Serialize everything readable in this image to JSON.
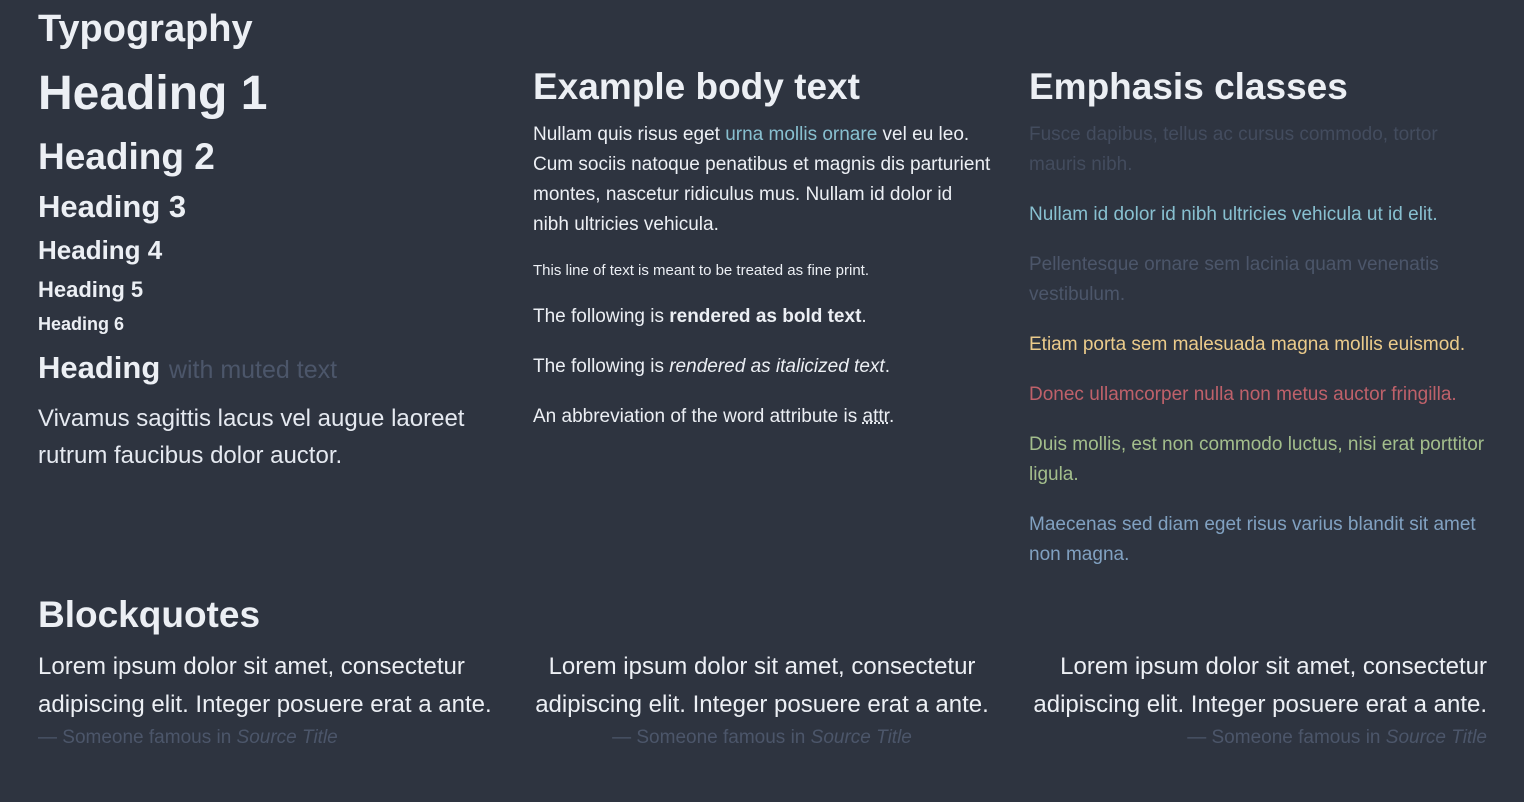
{
  "page": {
    "title": "Typography"
  },
  "headings": {
    "h1": "Heading 1",
    "h2": "Heading 2",
    "h3": "Heading 3",
    "h4": "Heading 4",
    "h5": "Heading 5",
    "h6": "Heading 6",
    "muted_heading": "Heading",
    "muted_text": "with muted text",
    "lead": "Vivamus sagittis lacus vel augue laoreet rutrum faucibus dolor auctor."
  },
  "body_text": {
    "title": "Example body text",
    "para_before_link": "Nullam quis risus eget ",
    "link_text": "urna mollis ornare",
    "para_after_link": " vel eu leo. Cum sociis natoque penatibus et magnis dis parturient montes, nascetur ridiculus mus. Nullam id dolor id nibh ultricies vehicula.",
    "fine_print": "This line of text is meant to be treated as fine print.",
    "bold_prefix": "The following is ",
    "bold_text": "rendered as bold text",
    "bold_suffix": ".",
    "italic_prefix": "The following is ",
    "italic_text": "rendered as italicized text",
    "italic_suffix": ".",
    "abbr_prefix": "An abbreviation of the word attribute is ",
    "abbr_text": "attr",
    "abbr_suffix": "."
  },
  "emphasis": {
    "title": "Emphasis classes",
    "items": [
      {
        "text": "Fusce dapibus, tellus ac cursus commodo, tortor mauris nibh.",
        "color": "#434c5e"
      },
      {
        "text": "Nullam id dolor id nibh ultricies vehicula ut id elit.",
        "color": "#88c0d0"
      },
      {
        "text": "Pellentesque ornare sem lacinia quam venenatis vestibulum.",
        "color": "#4c566a"
      },
      {
        "text": "Etiam porta sem malesuada magna mollis euismod.",
        "color": "#ebcb8b"
      },
      {
        "text": "Donec ullamcorper nulla non metus auctor fringilla.",
        "color": "#bf616a"
      },
      {
        "text": "Duis mollis, est non commodo luctus, nisi erat porttitor ligula.",
        "color": "#a3be8c"
      },
      {
        "text": "Maecenas sed diam eget risus varius blandit sit amet non magna.",
        "color": "#81a1c1"
      }
    ]
  },
  "blockquotes": {
    "title": "Blockquotes",
    "quote": "Lorem ipsum dolor sit amet, consectetur adipiscing elit. Integer posuere erat a ante.",
    "footer_prefix": "— Someone famous in ",
    "source": "Source Title"
  },
  "colors": {
    "background": "#2e3440",
    "text": "#eceff4",
    "muted": "#4c566a",
    "link": "#88c0d0"
  }
}
